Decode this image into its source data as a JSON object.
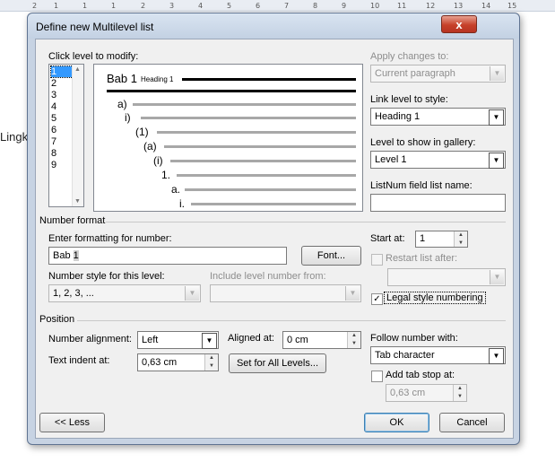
{
  "ruler": {
    "numbers": [
      "2",
      "1",
      "1",
      "1",
      "2",
      "3",
      "4",
      "5",
      "6",
      "7",
      "8",
      "9",
      "10",
      "11",
      "12",
      "13",
      "14",
      "15"
    ]
  },
  "document": {
    "text": "Lingk"
  },
  "dialog": {
    "title": "Define new Multilevel list",
    "close_label": "x",
    "click_level_label": "Click level to modify:",
    "levels": [
      "1",
      "2",
      "3",
      "4",
      "5",
      "6",
      "7",
      "8",
      "9"
    ],
    "selected_level": "1",
    "preview": {
      "heading_text": "Bab 1",
      "heading_style": "Heading 1",
      "items": [
        "a)",
        "i)",
        "(1)",
        "(a)",
        "(i)",
        "1.",
        "a.",
        "i."
      ]
    },
    "apply_changes_label": "Apply changes to:",
    "apply_changes_value": "Current paragraph",
    "link_level_label": "Link level to style:",
    "link_level_value": "Heading 1",
    "gallery_label": "Level to show in gallery:",
    "gallery_value": "Level 1",
    "listnum_label": "ListNum field list name:",
    "listnum_value": "",
    "number_format_section": "Number format",
    "enter_formatting_label": "Enter formatting for number:",
    "formatting_prefix": "Bab ",
    "formatting_number": "1",
    "font_button": "Font...",
    "number_style_label": "Number style for this level:",
    "number_style_value": "1, 2, 3, ...",
    "include_level_label": "Include level number from:",
    "include_level_value": "",
    "start_at_label": "Start at:",
    "start_at_value": "1",
    "restart_list_label": "Restart list after:",
    "restart_list_value": "",
    "legal_style_label": "Legal style numbering",
    "legal_style_checked": "✓",
    "position_section": "Position",
    "number_alignment_label": "Number alignment:",
    "number_alignment_value": "Left",
    "aligned_at_label": "Aligned at:",
    "aligned_at_value": "0 cm",
    "text_indent_label": "Text indent at:",
    "text_indent_value": "0,63 cm",
    "set_all_levels_button": "Set for All Levels...",
    "follow_number_label": "Follow number with:",
    "follow_number_value": "Tab character",
    "add_tab_stop_label": "Add tab stop at:",
    "add_tab_stop_value": "0,63 cm",
    "less_button": "<< Less",
    "ok_button": "OK",
    "cancel_button": "Cancel"
  },
  "colors": {
    "selection": "#3399ff",
    "dialog_frame": "#c7d3e3",
    "close_button": "#c6412a"
  }
}
